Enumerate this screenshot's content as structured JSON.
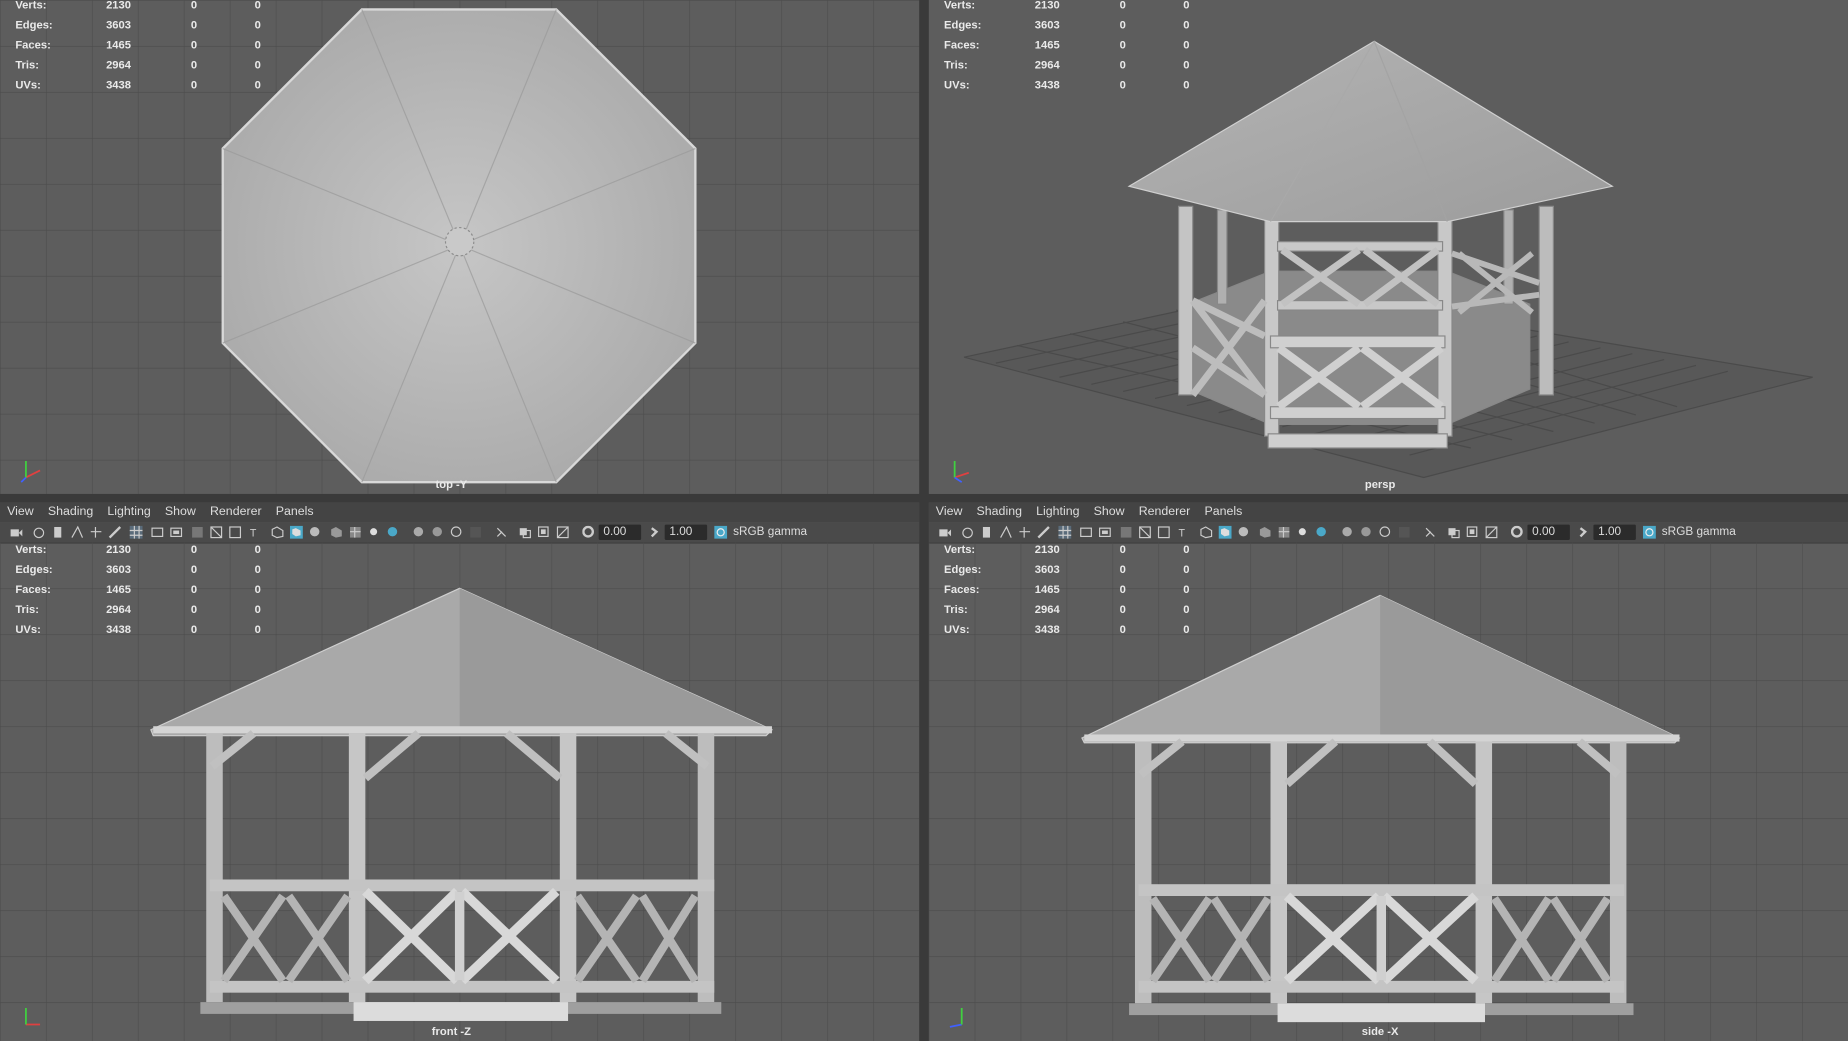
{
  "menu": [
    "View",
    "Shading",
    "Lighting",
    "Show",
    "Renderer",
    "Panels"
  ],
  "toolbar": {
    "exposure": "0.00",
    "gamma": "1.00",
    "color_space": "sRGB gamma"
  },
  "hud": {
    "labels": [
      "Verts:",
      "Edges:",
      "Faces:",
      "Tris:",
      "UVs:"
    ],
    "values": [
      "2130",
      "3603",
      "1465",
      "2964",
      "3438"
    ],
    "sel": [
      "0",
      "0",
      "0",
      "0",
      "0"
    ],
    "comp": [
      "0",
      "0",
      "0",
      "0",
      "0"
    ]
  },
  "viewports": {
    "top": {
      "camera": "top -Y"
    },
    "persp": {
      "camera": "persp"
    },
    "front": {
      "camera": "front -Z"
    },
    "side": {
      "camera": "side -X"
    }
  },
  "colors": {
    "grid_bg": "#5d5d5d",
    "grid_line": "#4a4a4a",
    "model": "#b5b5b5",
    "accent": "#5bc0de"
  }
}
